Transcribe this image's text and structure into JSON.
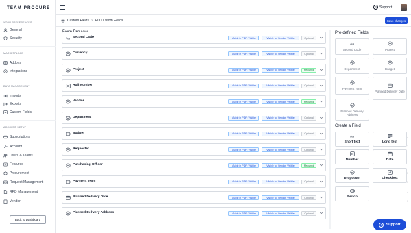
{
  "brand": "TEAM PROCURE",
  "sidebar": {
    "sections": [
      {
        "title": "YOUR PREFERENCES",
        "items": [
          {
            "label": "General",
            "icon": "user-icon"
          },
          {
            "label": "Security",
            "icon": "shield-icon"
          }
        ]
      },
      {
        "title": "MARKETPLACE",
        "items": [
          {
            "label": "Addons",
            "icon": "grid-icon"
          },
          {
            "label": "Integrations",
            "icon": "plug-icon"
          }
        ]
      },
      {
        "title": "DATA MANAGEMENT",
        "items": [
          {
            "label": "Imports",
            "icon": "import-icon"
          },
          {
            "label": "Exports",
            "icon": "export-icon"
          },
          {
            "label": "Custom Fields",
            "icon": "fields-icon"
          }
        ]
      },
      {
        "title": "ACCOUNT SETUP",
        "items": [
          {
            "label": "Subscriptions",
            "icon": "card-icon",
            "chevron": true
          },
          {
            "label": "Account",
            "icon": "wrench-icon",
            "chevron": true
          },
          {
            "label": "Users & Teams",
            "icon": "users-icon"
          },
          {
            "label": "Features",
            "icon": "list-icon"
          },
          {
            "label": "Procurement",
            "icon": "box-icon",
            "chevron": true
          },
          {
            "label": "Request Management",
            "icon": "inbox-icon",
            "chevron": true
          },
          {
            "label": "RFQ Management",
            "icon": "doc-icon",
            "chevron": true
          },
          {
            "label": "Vendor",
            "icon": "store-icon",
            "chevron": true
          }
        ]
      }
    ],
    "back_button": "Back to Dashboard"
  },
  "topbar": {
    "support_label": "Support"
  },
  "breadcrumb": {
    "parent": "Custom Fields",
    "separator": ">",
    "current": "PO Custom Fields"
  },
  "save_button": "Save changes",
  "form_preview": {
    "title": "Form Preview",
    "pdf_tag": "Visible in PDF: Visible",
    "vendor_tag": "Visible for Vendor: Visible",
    "fields": [
      {
        "name": "Second Code",
        "icon": "text-icon",
        "required": "Optional"
      },
      {
        "name": "Currency",
        "icon": "dropdown-icon",
        "required": "Optional"
      },
      {
        "name": "Project",
        "icon": "dropdown-icon",
        "required": "Required"
      },
      {
        "name": "Hull Number",
        "icon": "number-icon",
        "required": "Optional"
      },
      {
        "name": "Vendor",
        "icon": "dropdown-icon",
        "required": "Required"
      },
      {
        "name": "Department",
        "icon": "dropdown-icon",
        "required": "Optional"
      },
      {
        "name": "Budget",
        "icon": "dropdown-icon",
        "required": "Optional"
      },
      {
        "name": "Requester",
        "icon": "dropdown-icon",
        "required": "Optional"
      },
      {
        "name": "Purchasing Officer",
        "icon": "dropdown-icon",
        "required": "Required"
      },
      {
        "name": "Payment Term",
        "icon": "dropdown-icon",
        "required": "Optional"
      },
      {
        "name": "Planned Delivery Date",
        "icon": "calendar-icon",
        "required": "Optional"
      },
      {
        "name": "Planned Delivery Address",
        "icon": "dropdown-icon",
        "required": "Optional"
      }
    ]
  },
  "predefined": {
    "title": "Pre-defined Fields",
    "items": [
      {
        "label": "Second Code",
        "icon": "text-icon"
      },
      {
        "label": "Project",
        "icon": "dropdown-icon"
      },
      {
        "label": "Department",
        "icon": "dropdown-icon"
      },
      {
        "label": "Budget",
        "icon": "dropdown-icon"
      },
      {
        "label": "Payment Term",
        "icon": "dropdown-icon"
      },
      {
        "label": "Planned Delivery Date",
        "icon": "calendar-icon"
      },
      {
        "label": "Planned Delivery Address",
        "icon": "dropdown-icon"
      }
    ]
  },
  "create_field": {
    "title": "Create a Field",
    "items": [
      {
        "label": "Short text",
        "icon": "text-icon"
      },
      {
        "label": "Long text",
        "icon": "long-text-icon"
      },
      {
        "label": "Number",
        "icon": "number-icon"
      },
      {
        "label": "Date",
        "icon": "calendar-icon"
      },
      {
        "label": "Dropdown",
        "icon": "dropdown-icon"
      },
      {
        "label": "Checkbox",
        "icon": "checkbox-icon"
      },
      {
        "label": "Switch",
        "icon": "switch-icon"
      }
    ]
  },
  "support_fab": "Support",
  "colors": {
    "primary": "#1d4ed8",
    "required": "#15803d",
    "optional": "#6b7280"
  }
}
